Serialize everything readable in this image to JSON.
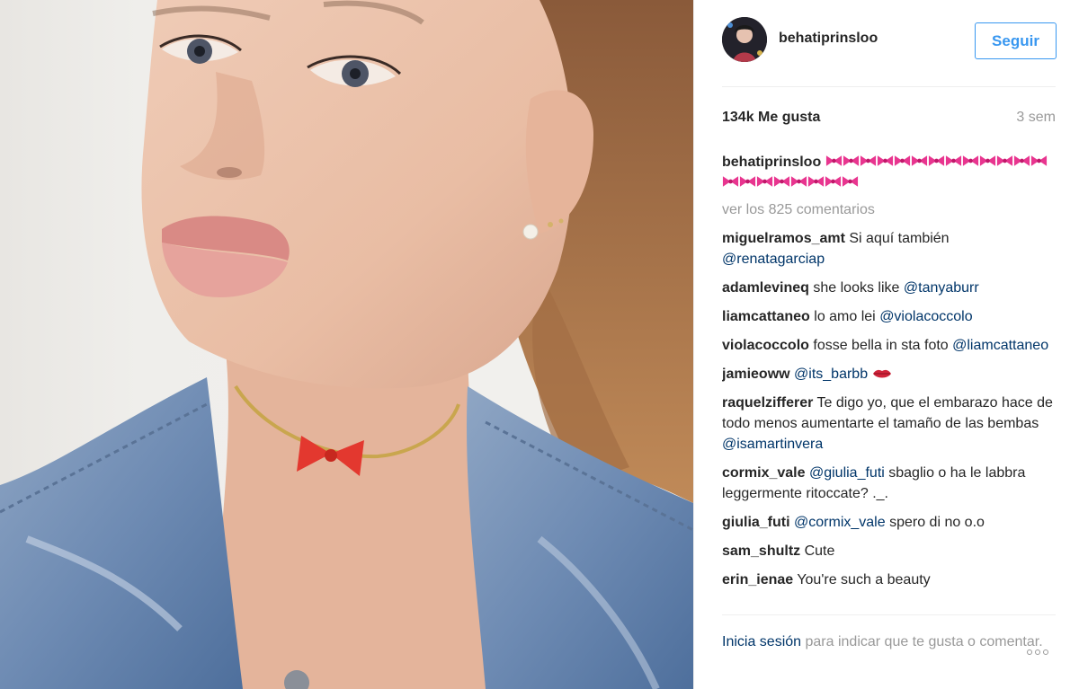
{
  "post": {
    "image_alt": "selfie photo",
    "header": {
      "username": "behatiprinsloo",
      "follow_label": "Seguir"
    },
    "likes": {
      "count_text": "134k Me gusta"
    },
    "time_ago": "3 sem",
    "caption": {
      "user": "behatiprinsloo",
      "emoji": "ribbon",
      "emoji_count": 21
    },
    "view_all_label": "ver los 825 comentarios",
    "comments": [
      {
        "user": "miguelramos_amt",
        "text": " Si aquí también ",
        "mention": "@renatagarciap",
        "after": ""
      },
      {
        "user": "adamlevineq",
        "text": " she looks like ",
        "mention": "@tanyaburr",
        "after": ""
      },
      {
        "user": "liamcattaneo",
        "text": " lo amo lei ",
        "mention": "@violacoccolo",
        "after": ""
      },
      {
        "user": "violacoccolo",
        "text": " fosse bella in sta foto ",
        "mention": "@liamcattaneo",
        "after": ""
      },
      {
        "user": "jamieoww",
        "text": " ",
        "mention": "@its_barbb",
        "after": " "
      },
      {
        "user": "raquelzifferer",
        "text": " Te digo yo, que el embarazo hace de todo menos aumentarte el tamaño de las bembas ",
        "mention": "@isamartinvera",
        "after": ""
      },
      {
        "user": "cormix_vale",
        "text": " ",
        "mention": "@giulia_futi",
        "after": " sbaglio o ha le labbra leggermente ritoccate? ._."
      },
      {
        "user": "giulia_futi",
        "text": " ",
        "mention": "@cormix_vale",
        "after": " spero di no o.o"
      },
      {
        "user": "sam_shultz",
        "text": " Cute",
        "mention": "",
        "after": ""
      },
      {
        "user": "erin_ienae",
        "text": " You're such a beauty",
        "mention": "",
        "after": ""
      }
    ],
    "footer": {
      "login_label": "Inicia sesión",
      "rest_text": " para indicar que te gusta o comentar."
    },
    "colors": {
      "accent": "#3897f0",
      "mention": "#003569",
      "muted": "#999999",
      "text": "#262626",
      "bow": "#e8358f"
    }
  }
}
